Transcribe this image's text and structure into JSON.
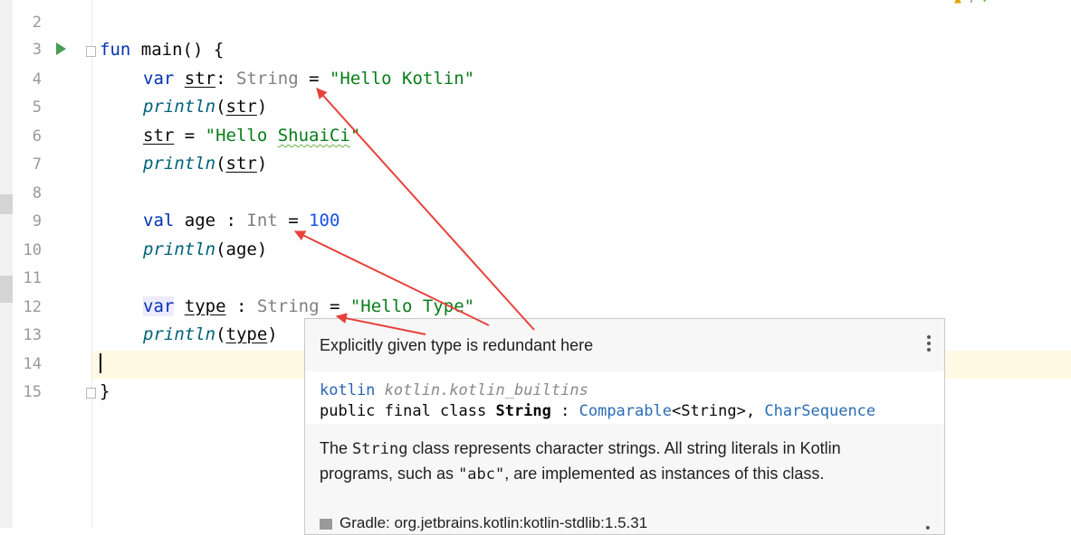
{
  "line_numbers": [
    "2",
    "3",
    "4",
    "5",
    "6",
    "7",
    "8",
    "9",
    "10",
    "11",
    "12",
    "13",
    "14",
    "15"
  ],
  "code": {
    "line3": {
      "kw": "fun",
      "name": " main() {"
    },
    "line4": {
      "kw": "var",
      "var": "str",
      "colon": ": ",
      "type": "String",
      "eq": " = ",
      "str": "\"Hello Kotlin\""
    },
    "line5": {
      "fn": "println",
      "open": "(",
      "arg": "str",
      "close": ")"
    },
    "line6": {
      "var": "str",
      "eq": " = ",
      "str_a": "\"Hello ",
      "str_b": "ShuaiCi",
      "str_c": "\""
    },
    "line7": {
      "fn": "println",
      "open": "(",
      "arg": "str",
      "close": ")"
    },
    "line9": {
      "kw": "val",
      "name": " age ",
      "colon": ": ",
      "type": "Int",
      "eq": " = ",
      "num": "100"
    },
    "line10": {
      "fn": "println",
      "open": "(",
      "arg": "age",
      "close": ")"
    },
    "line12": {
      "kw": "var",
      "space": " ",
      "var": "type",
      "colon": " : ",
      "type": "String",
      "eq": " = ",
      "str": "\"Hello Type\""
    },
    "line13": {
      "fn": "println",
      "open": "(",
      "arg": "type",
      "close": ")"
    },
    "line15": {
      "brace": "}"
    }
  },
  "popup": {
    "message": "Explicitly given type is redundant here",
    "package_name": "kotlin",
    "package_path": "kotlin.kotlin_builtins",
    "decl_prefix": "public final class ",
    "decl_name": "String",
    "decl_colon": " : ",
    "decl_super1": "Comparable",
    "decl_generic": "<String>, ",
    "decl_super2": "CharSequence",
    "doc_1": "The ",
    "doc_code1": "String",
    "doc_2": " class represents character strings. All string literals in Kotlin programs, such as ",
    "doc_code2": "\"abc\"",
    "doc_3": ", are implemented as instances of this class.",
    "gradle": "Gradle: org.jetbrains.kotlin:kotlin-stdlib:1.5.31"
  },
  "icons": {
    "run": "run-gutter-icon",
    "fold": "fold-marker-icon",
    "more": "more-vertical-icon",
    "library": "library-icon",
    "warning": "warning-indicator-icon"
  },
  "colors": {
    "keyword": "#0033b3",
    "string": "#067d17",
    "number": "#1750eb",
    "function": "#00627a",
    "arrow": "#e8413c",
    "current_line": "#fffae3"
  }
}
